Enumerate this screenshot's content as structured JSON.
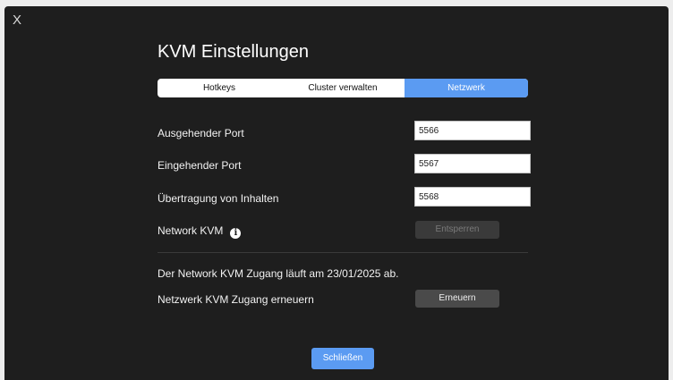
{
  "window": {
    "close_label": "X"
  },
  "dialog": {
    "title": "KVM Einstellungen"
  },
  "tabs": [
    {
      "label": "Hotkeys",
      "active": false
    },
    {
      "label": "Cluster verwalten",
      "active": false
    },
    {
      "label": "Netzwerk",
      "active": true
    }
  ],
  "settings": {
    "outgoing_port": {
      "label": "Ausgehender Port",
      "value": "5566"
    },
    "incoming_port": {
      "label": "Eingehender Port",
      "value": "5567"
    },
    "content_transfer": {
      "label": "Übertragung von Inhalten",
      "value": "5568"
    },
    "network_kvm": {
      "label": "Network KVM",
      "unlock_label": "Entsperren"
    }
  },
  "license": {
    "expiry_text": "Der Network KVM Zugang läuft am 23/01/2025 ab.",
    "renew_label": "Netzwerk KVM Zugang erneuern",
    "renew_button": "Erneuern"
  },
  "footer": {
    "close_button": "Schließen"
  },
  "colors": {
    "accent": "#5b9bf2",
    "background": "#1e1e1e"
  }
}
